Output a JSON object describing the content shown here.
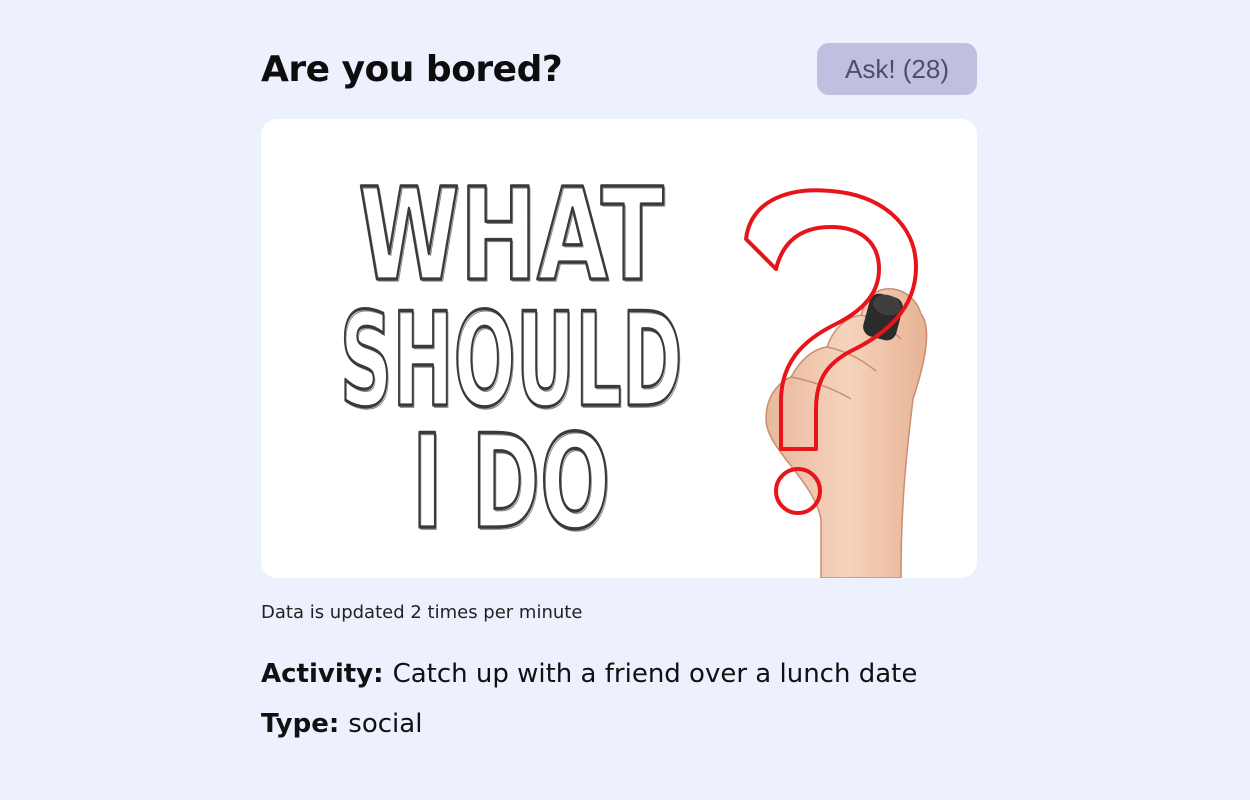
{
  "header": {
    "title": "Are you bored?",
    "ask_button_label": "Ask! (28)"
  },
  "illustration": {
    "line1": "WHAT",
    "line2": "SHOULD",
    "line3": "I DO",
    "question_mark": "?"
  },
  "update_note": "Data is updated 2 times per minute",
  "activity": {
    "label": "Activity:",
    "value": "Catch up with a friend over a lunch date"
  },
  "type": {
    "label": "Type:",
    "value": "social"
  },
  "colors": {
    "background": "#edf0fd",
    "button_bg": "#bfbfe0",
    "button_text": "#4e4e6a",
    "question_red": "#e8141b",
    "sketch_text": "#3a3a3a",
    "skin": "#f0c7ad"
  },
  "icons": {
    "illustration": "what-should-i-do-illustration",
    "hand": "hand-with-marker-icon"
  }
}
